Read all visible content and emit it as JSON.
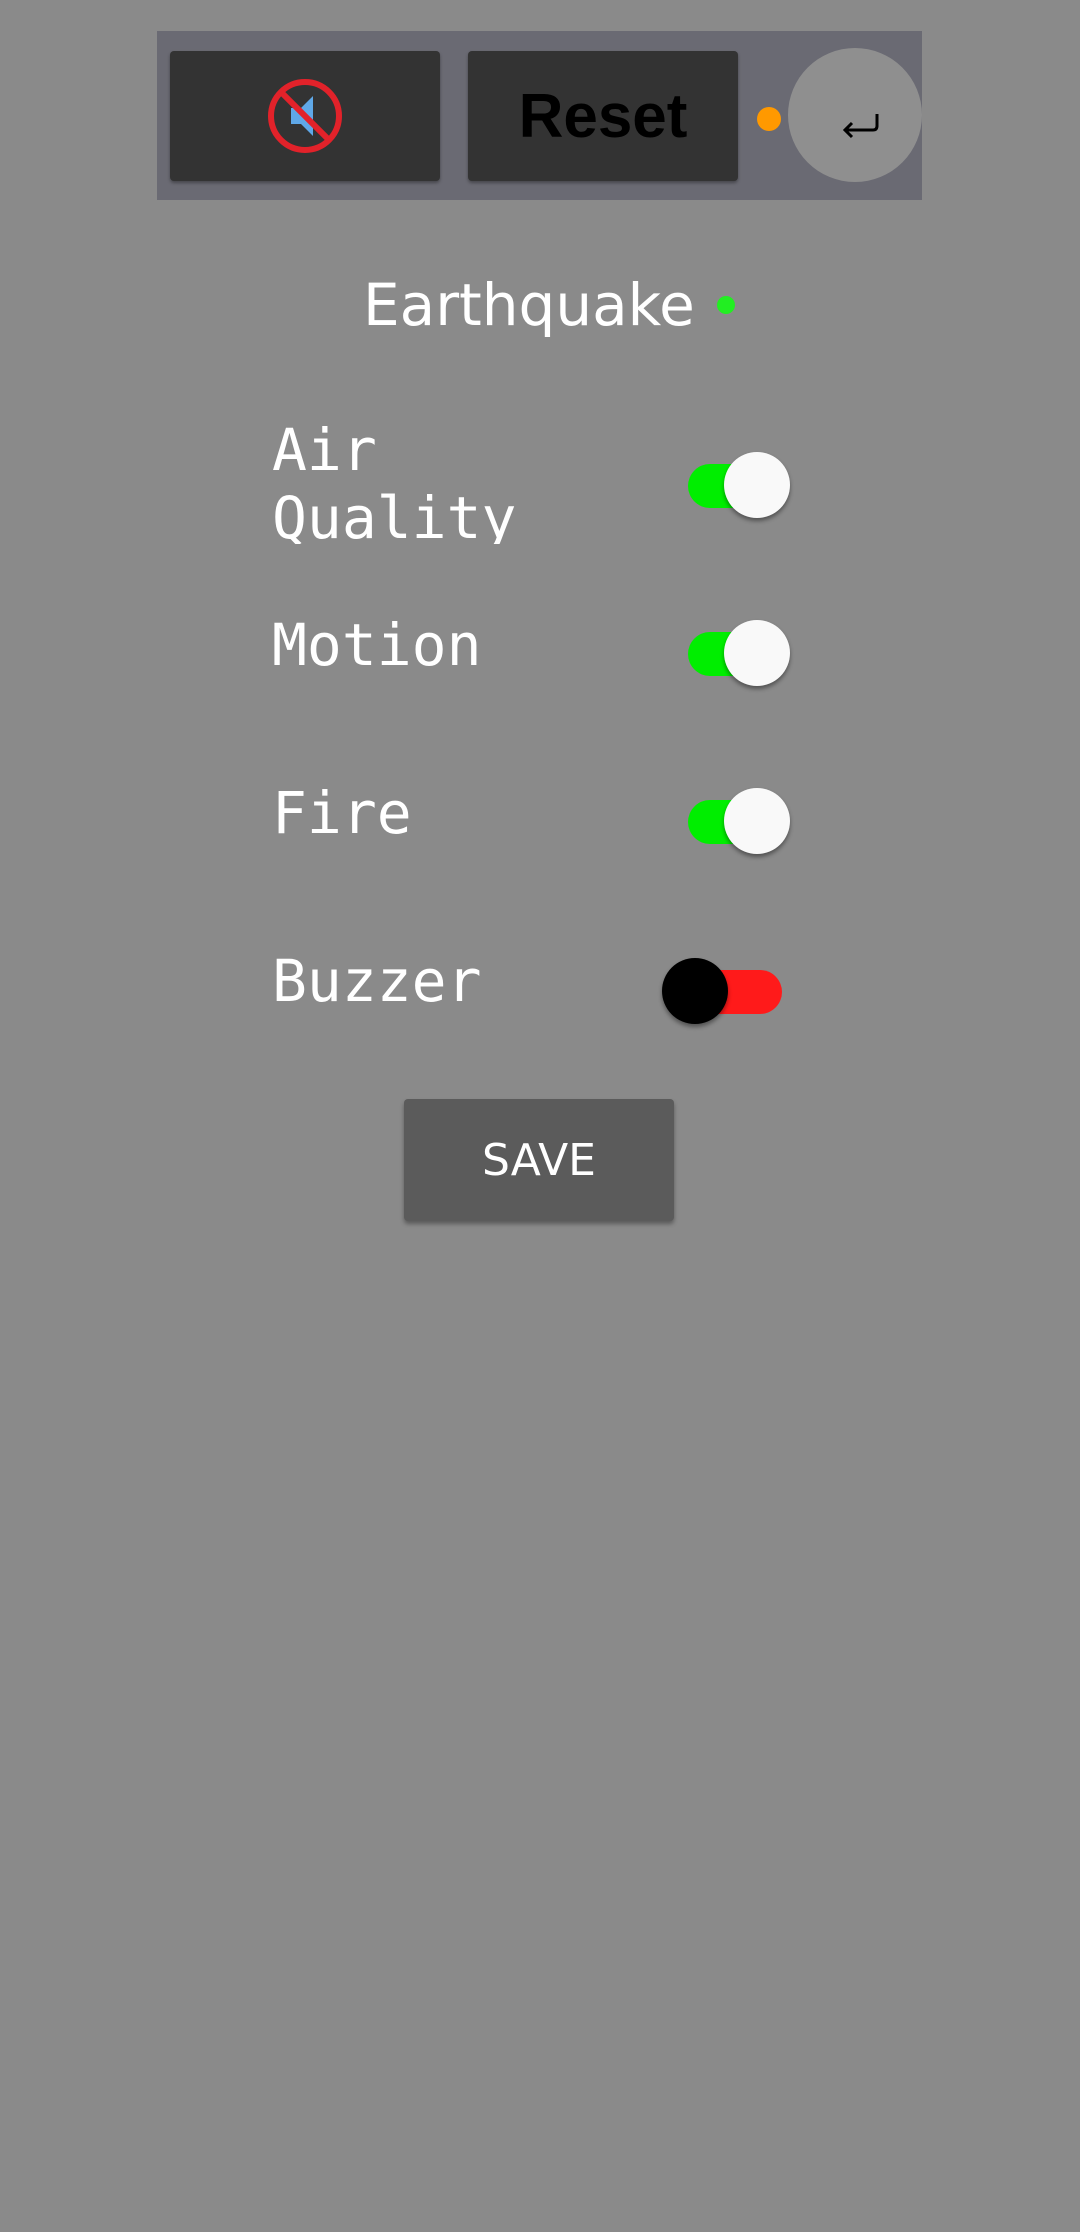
{
  "toolbar": {
    "mute_icon": "speaker-muted-icon",
    "reset_label": "Reset",
    "status_dot_color": "#ff9900",
    "back_icon": "return-arrow-icon"
  },
  "status": {
    "earthquake_label": "Earthquake",
    "earthquake_dot_color": "#22ee22"
  },
  "settings": {
    "air_quality": {
      "label": "Air\nQuality",
      "on": true
    },
    "motion": {
      "label": "Motion",
      "on": true
    },
    "fire": {
      "label": "Fire",
      "on": true
    },
    "buzzer": {
      "label": "Buzzer",
      "on": false
    }
  },
  "colors": {
    "background": "#8a8a8a",
    "toggle_on": "#00ee00",
    "toggle_off": "#ff1a1a"
  },
  "save_label": "SAVE"
}
